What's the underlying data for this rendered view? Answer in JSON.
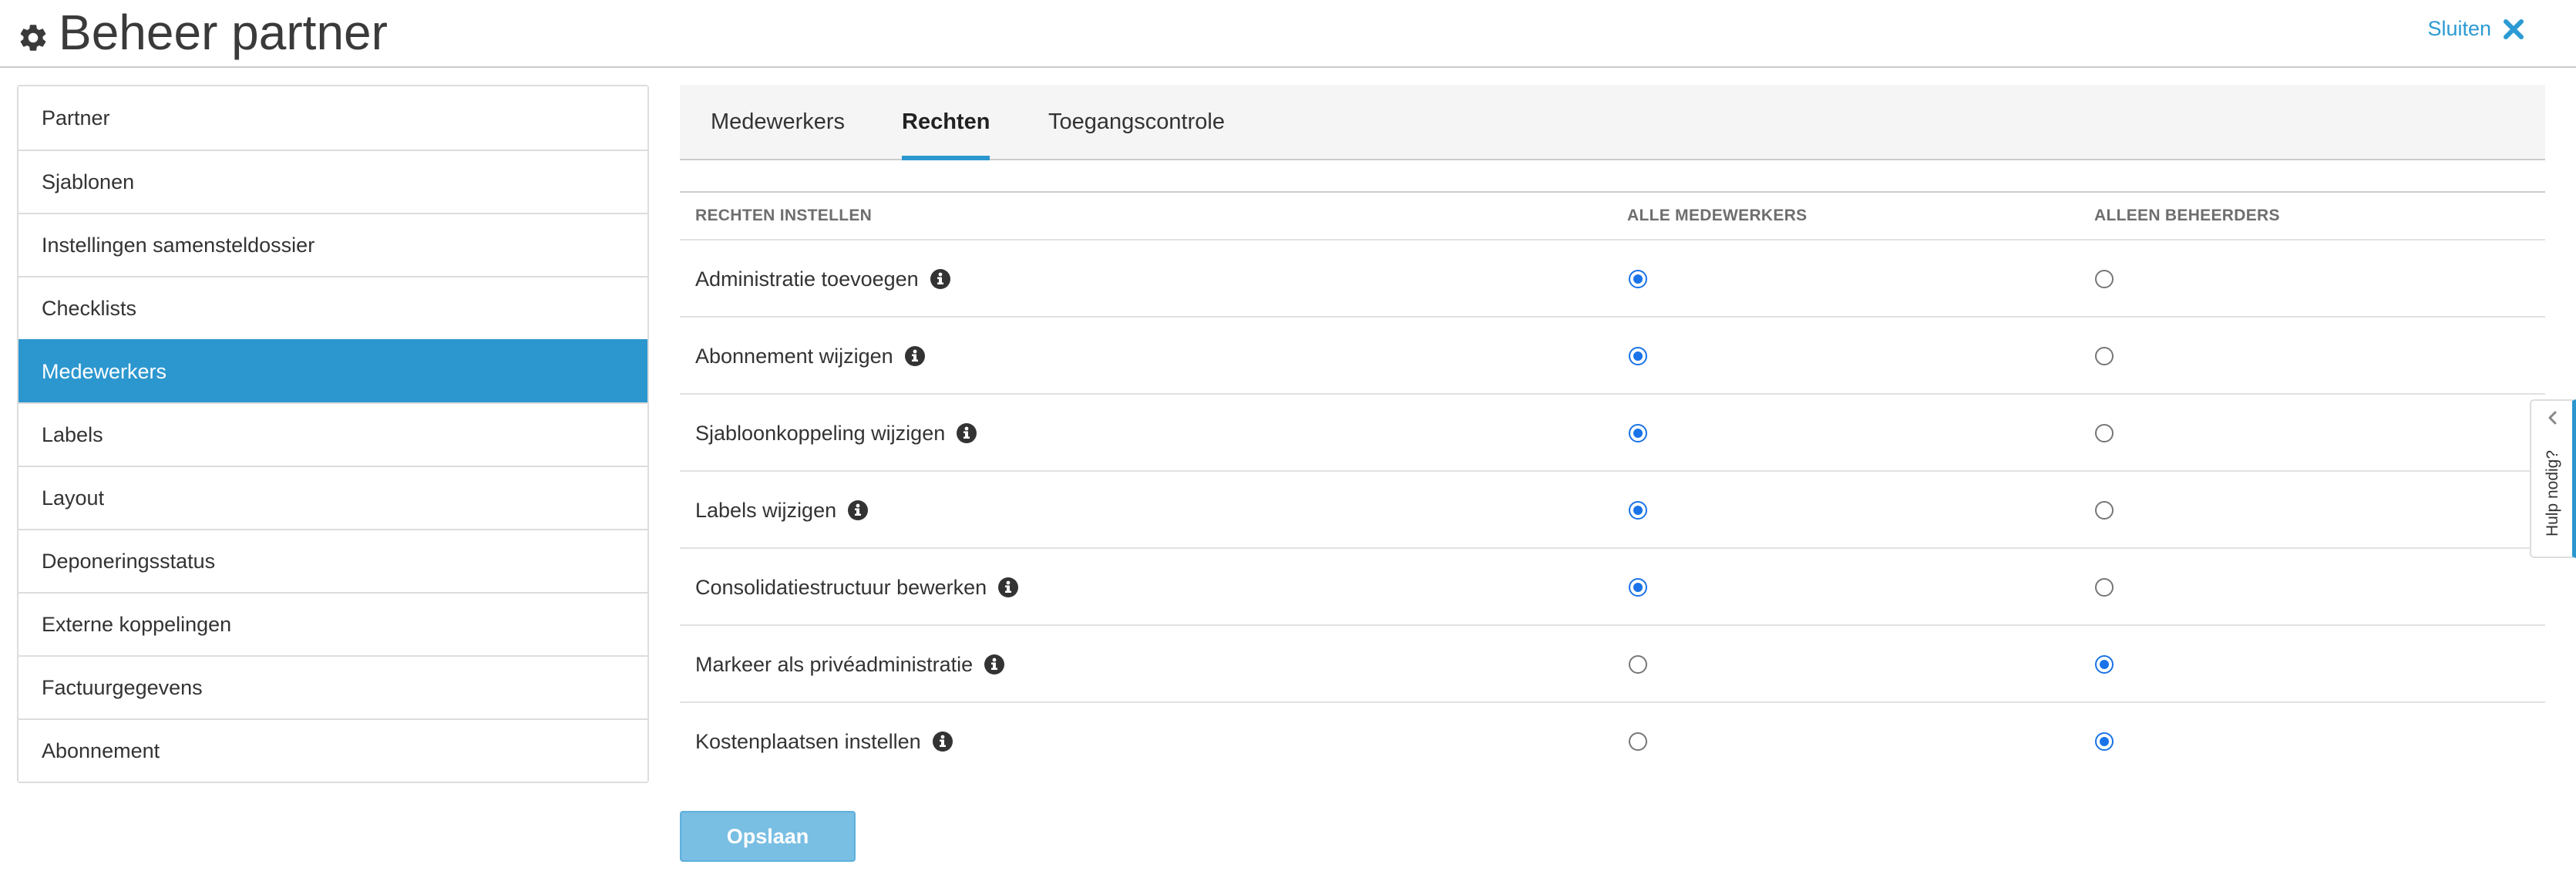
{
  "header": {
    "title": "Beheer partner",
    "close_label": "Sluiten"
  },
  "sidebar": {
    "items": [
      {
        "label": "Partner",
        "active": false
      },
      {
        "label": "Sjablonen",
        "active": false
      },
      {
        "label": "Instellingen samensteldossier",
        "active": false
      },
      {
        "label": "Checklists",
        "active": false
      },
      {
        "label": "Medewerkers",
        "active": true
      },
      {
        "label": "Labels",
        "active": false
      },
      {
        "label": "Layout",
        "active": false
      },
      {
        "label": "Deponeringsstatus",
        "active": false
      },
      {
        "label": "Externe koppelingen",
        "active": false
      },
      {
        "label": "Factuurgegevens",
        "active": false
      },
      {
        "label": "Abonnement",
        "active": false
      }
    ]
  },
  "tabs": [
    {
      "label": "Medewerkers",
      "active": false
    },
    {
      "label": "Rechten",
      "active": true
    },
    {
      "label": "Toegangscontrole",
      "active": false
    }
  ],
  "rights_table": {
    "headers": [
      "RECHTEN INSTELLEN",
      "ALLE MEDEWERKERS",
      "ALLEEN BEHEERDERS"
    ],
    "rows": [
      {
        "label": "Administratie toevoegen",
        "selected": "ALLE MEDEWERKERS"
      },
      {
        "label": "Abonnement wijzigen",
        "selected": "ALLE MEDEWERKERS"
      },
      {
        "label": "Sjabloonkoppeling wijzigen",
        "selected": "ALLE MEDEWERKERS"
      },
      {
        "label": "Labels wijzigen",
        "selected": "ALLE MEDEWERKERS"
      },
      {
        "label": "Consolidatiestructuur bewerken",
        "selected": "ALLE MEDEWERKERS"
      },
      {
        "label": "Markeer als privéadministratie",
        "selected": "ALLEEN BEHEERDERS"
      },
      {
        "label": "Kostenplaatsen instellen",
        "selected": "ALLEEN BEHEERDERS"
      }
    ]
  },
  "save_label": "Opslaan",
  "help": {
    "label": "Hulp nodig?"
  },
  "colors": {
    "accent": "#2c97cf",
    "link": "#2c9ad3",
    "radio_checked": "#1a73e8",
    "save_button": "#79bee3"
  },
  "icons": {
    "title": "gear-icon",
    "close": "close-icon",
    "row_info": "info-icon",
    "help": "chevron-left-icon"
  }
}
